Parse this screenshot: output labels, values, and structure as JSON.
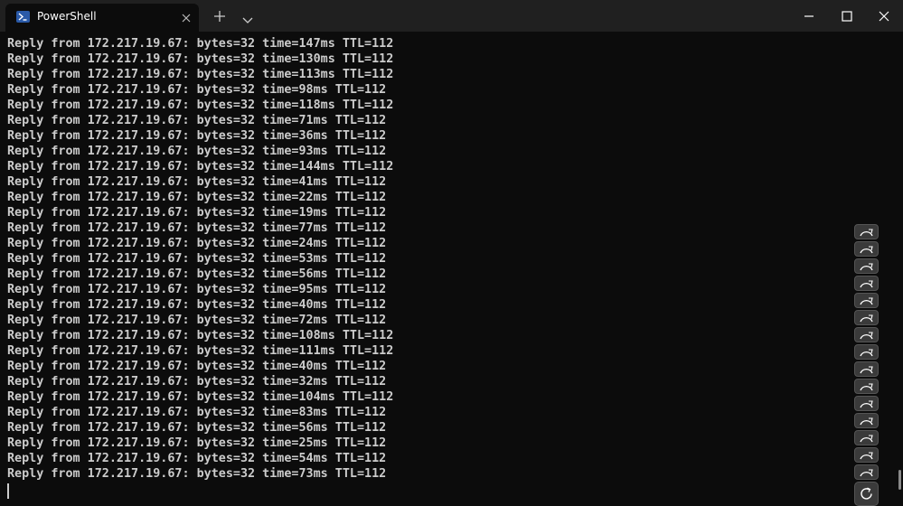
{
  "window": {
    "tab_title": "PowerShell",
    "icons": {
      "tab": "powershell-icon",
      "close_tab": "close-icon",
      "new_tab": "plus-icon",
      "dropdown": "chevron-down-icon",
      "minimize": "minimize-icon",
      "maximize": "maximize-icon",
      "close_window": "close-icon"
    }
  },
  "terminal": {
    "lines": [
      "Reply from 172.217.19.67: bytes=32 time=147ms TTL=112",
      "Reply from 172.217.19.67: bytes=32 time=130ms TTL=112",
      "Reply from 172.217.19.67: bytes=32 time=113ms TTL=112",
      "Reply from 172.217.19.67: bytes=32 time=98ms TTL=112",
      "Reply from 172.217.19.67: bytes=32 time=118ms TTL=112",
      "Reply from 172.217.19.67: bytes=32 time=71ms TTL=112",
      "Reply from 172.217.19.67: bytes=32 time=36ms TTL=112",
      "Reply from 172.217.19.67: bytes=32 time=93ms TTL=112",
      "Reply from 172.217.19.67: bytes=32 time=144ms TTL=112",
      "Reply from 172.217.19.67: bytes=32 time=41ms TTL=112",
      "Reply from 172.217.19.67: bytes=32 time=22ms TTL=112",
      "Reply from 172.217.19.67: bytes=32 time=19ms TTL=112",
      "Reply from 172.217.19.67: bytes=32 time=77ms TTL=112",
      "Reply from 172.217.19.67: bytes=32 time=24ms TTL=112",
      "Reply from 172.217.19.67: bytes=32 time=53ms TTL=112",
      "Reply from 172.217.19.67: bytes=32 time=56ms TTL=112",
      "Reply from 172.217.19.67: bytes=32 time=95ms TTL=112",
      "Reply from 172.217.19.67: bytes=32 time=40ms TTL=112",
      "Reply from 172.217.19.67: bytes=32 time=72ms TTL=112",
      "Reply from 172.217.19.67: bytes=32 time=108ms TTL=112",
      "Reply from 172.217.19.67: bytes=32 time=111ms TTL=112",
      "Reply from 172.217.19.67: bytes=32 time=40ms TTL=112",
      "Reply from 172.217.19.67: bytes=32 time=32ms TTL=112",
      "Reply from 172.217.19.67: bytes=32 time=104ms TTL=112",
      "Reply from 172.217.19.67: bytes=32 time=83ms TTL=112",
      "Reply from 172.217.19.67: bytes=32 time=56ms TTL=112",
      "Reply from 172.217.19.67: bytes=32 time=25ms TTL=112",
      "Reply from 172.217.19.67: bytes=32 time=54ms TTL=112",
      "Reply from 172.217.19.67: bytes=32 time=73ms TTL=112"
    ],
    "side_button_icon": "refresh-icon",
    "colors": {
      "background": "#0c0c0c",
      "text": "#cccccc",
      "titlebar": "#202020"
    }
  }
}
